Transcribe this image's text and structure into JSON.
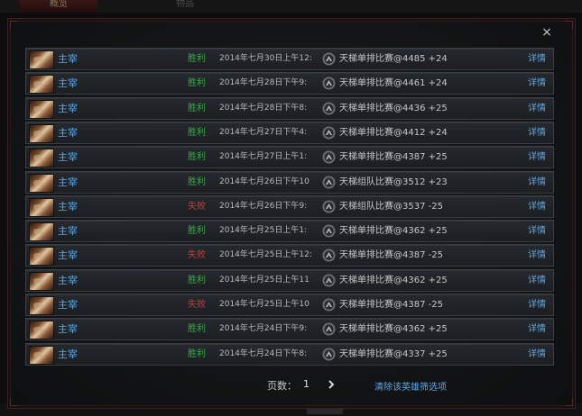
{
  "background": {
    "tab_active": "概览",
    "tab_other": "物品"
  },
  "dialog": {
    "close_label": "×",
    "rows": [
      {
        "player": "主宰",
        "result": "胜利",
        "result_type": "win",
        "date": "2014年七月30日上午12:",
        "mode": "天梯单排比赛@4485 +24",
        "detail": "详情"
      },
      {
        "player": "主宰",
        "result": "胜利",
        "result_type": "win",
        "date": "2014年七月28日下午9:",
        "mode": "天梯单排比赛@4461 +24",
        "detail": "详情"
      },
      {
        "player": "主宰",
        "result": "胜利",
        "result_type": "win",
        "date": "2014年七月28日下午8:",
        "mode": "天梯单排比赛@4436 +25",
        "detail": "详情"
      },
      {
        "player": "主宰",
        "result": "胜利",
        "result_type": "win",
        "date": "2014年七月27日下午4:",
        "mode": "天梯单排比赛@4412 +24",
        "detail": "详情"
      },
      {
        "player": "主宰",
        "result": "胜利",
        "result_type": "win",
        "date": "2014年七月27日上午1:",
        "mode": "天梯单排比赛@4387 +25",
        "detail": "详情"
      },
      {
        "player": "主宰",
        "result": "胜利",
        "result_type": "win",
        "date": "2014年七月26日下午10",
        "mode": "天梯组队比赛@3512 +23",
        "detail": "详情"
      },
      {
        "player": "主宰",
        "result": "失败",
        "result_type": "lose",
        "date": "2014年七月26日下午9:",
        "mode": "天梯组队比赛@3537 -25",
        "detail": "详情"
      },
      {
        "player": "主宰",
        "result": "胜利",
        "result_type": "win",
        "date": "2014年七月25日上午1:",
        "mode": "天梯单排比赛@4362 +25",
        "detail": "详情"
      },
      {
        "player": "主宰",
        "result": "失败",
        "result_type": "lose",
        "date": "2014年七月25日上午12:",
        "mode": "天梯单排比赛@4387 -25",
        "detail": "详情"
      },
      {
        "player": "主宰",
        "result": "胜利",
        "result_type": "win",
        "date": "2014年七月25日上午11",
        "mode": "天梯单排比赛@4362 +25",
        "detail": "详情"
      },
      {
        "player": "主宰",
        "result": "失败",
        "result_type": "lose",
        "date": "2014年七月25日上午10",
        "mode": "天梯单排比赛@4387 -25",
        "detail": "详情"
      },
      {
        "player": "主宰",
        "result": "胜利",
        "result_type": "win",
        "date": "2014年七月24日下午9:",
        "mode": "天梯单排比赛@4362 +25",
        "detail": "详情"
      },
      {
        "player": "主宰",
        "result": "胜利",
        "result_type": "win",
        "date": "2014年七月24日下午8:",
        "mode": "天梯单排比赛@4337 +25",
        "detail": "详情"
      }
    ],
    "hero_icon": "hero-portrait-icon",
    "mode_icon": "ranked-matchmaking-icon"
  },
  "pager": {
    "label": "页数：",
    "page": "1",
    "next_icon": "chevron-right-icon",
    "clear_filter": "清除该英雄筛选项"
  },
  "colors": {
    "win": "#3aa84a",
    "lose": "#b8443a",
    "link": "#5aa8e8"
  }
}
